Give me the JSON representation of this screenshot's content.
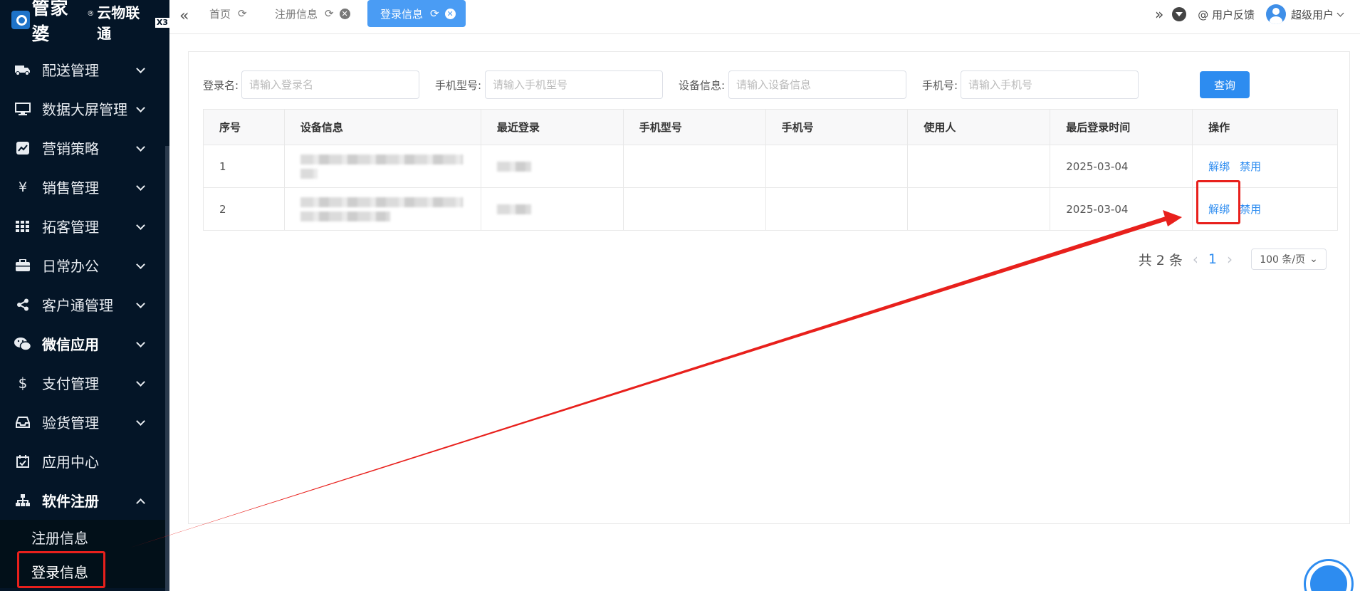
{
  "sidebar": {
    "logo": {
      "brand": "管家婆",
      "reg": "®",
      "product": "云物联通",
      "edition": "X3"
    },
    "items": [
      {
        "label": "配送管理",
        "icon": "truck-icon"
      },
      {
        "label": "数据大屏管理",
        "icon": "monitor-icon"
      },
      {
        "label": "营销策略",
        "icon": "chart-icon"
      },
      {
        "label": "销售管理",
        "icon": "yen-icon"
      },
      {
        "label": "拓客管理",
        "icon": "grid-icon"
      },
      {
        "label": "日常办公",
        "icon": "briefcase-icon"
      },
      {
        "label": "客户通管理",
        "icon": "share-icon"
      },
      {
        "label": "微信应用",
        "icon": "wechat-icon"
      },
      {
        "label": "支付管理",
        "icon": "dollar-icon"
      },
      {
        "label": "验货管理",
        "icon": "inbox-icon"
      },
      {
        "label": "应用中心",
        "icon": "calendar-check-icon"
      },
      {
        "label": "软件注册",
        "icon": "sitemap-icon"
      }
    ],
    "sub_items": [
      {
        "label": "注册信息"
      },
      {
        "label": "登录信息"
      }
    ]
  },
  "topbar": {
    "collapse_glyph": "«",
    "tabs": [
      {
        "label": "首页"
      },
      {
        "label": "注册信息"
      },
      {
        "label": "登录信息"
      }
    ],
    "more_glyph": "»",
    "feedback": "@ 用户反馈",
    "user": "超级用户"
  },
  "filters": {
    "login_name": {
      "label": "登录名:",
      "placeholder": "请输入登录名"
    },
    "phone_model": {
      "label": "手机型号:",
      "placeholder": "请输入手机型号"
    },
    "device_info": {
      "label": "设备信息:",
      "placeholder": "请输入设备信息"
    },
    "phone_number": {
      "label": "手机号:",
      "placeholder": "请输入手机号"
    },
    "query_button": "查询"
  },
  "table": {
    "headers": [
      "序号",
      "设备信息",
      "最近登录",
      "手机型号",
      "手机号",
      "使用人",
      "最后登录时间",
      "操作"
    ],
    "rows": [
      {
        "index": "1",
        "last_login_time": "2025-03-04",
        "unbind": "解绑",
        "disable": "禁用"
      },
      {
        "index": "2",
        "last_login_time": "2025-03-04",
        "unbind": "解绑",
        "disable": "禁用"
      }
    ]
  },
  "pagination": {
    "total": "共 2 条",
    "current_page": "1",
    "page_size": "100 条/页"
  },
  "colors": {
    "sidebar_bg": "#041527",
    "accent": "#2d8cf0",
    "tab_active": "#4a9cf4",
    "annotation": "#e8201c"
  }
}
